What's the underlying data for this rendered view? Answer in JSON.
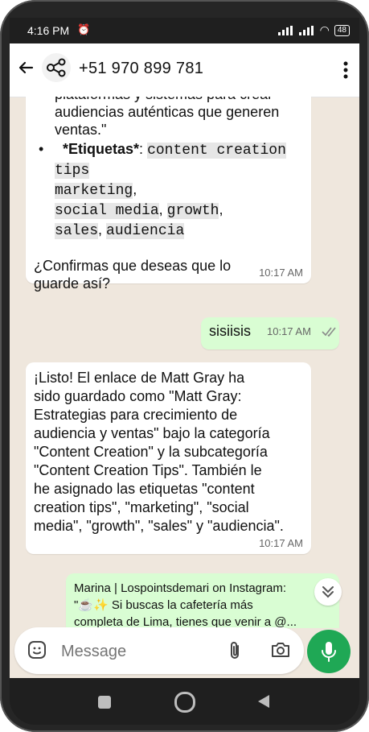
{
  "status": {
    "time": "4:16 PM",
    "battery": "48"
  },
  "header": {
    "contact": "+51 970 899 781"
  },
  "chat": {
    "msg1": {
      "text_line1": "plataformas y sistemas para crear",
      "text_line2": "audiencias auténticas que generen",
      "text_line3": "ventas.\"",
      "tags_label": "*Etiquetas*",
      "tags_colon": ":",
      "tags": [
        "content creation tips",
        "marketing",
        "social media",
        "growth",
        "sales",
        "audiencia"
      ],
      "confirm_line1": "¿Confirmas que deseas que lo",
      "confirm_line2": "guarde así?",
      "time": "10:17 AM"
    },
    "msg2": {
      "text": "sisiisis",
      "time": "10:17 AM"
    },
    "msg3": {
      "lines": [
        "¡Listo! El enlace de Matt Gray ha",
        "sido guardado como \"Matt Gray:",
        "Estrategias para crecimiento de",
        "audiencia y ventas\" bajo la categoría",
        "\"Content Creation\" y la subcategoría",
        "\"Content Creation Tips\". También le",
        "he asignado las etiquetas \"content",
        "creation tips\", \"marketing\", \"social",
        "media\", \"growth\", \"sales\" y \"audiencia\"."
      ],
      "time": "10:17 AM"
    },
    "msg4": {
      "line1": "Marina | Lospointsdemari on Instagram:",
      "line2": "\"☕✨ Si buscas la cafetería más",
      "line3": "completa de Lima, tienes que venir a @..."
    }
  },
  "composer": {
    "placeholder": "Message"
  },
  "icons": {
    "back": "back-arrow-icon",
    "share": "share-icon",
    "more": "more-vertical-icon",
    "emoji": "emoji-icon",
    "attach": "paperclip-icon",
    "camera": "camera-icon",
    "mic": "mic-icon",
    "nav_square": "square-icon",
    "nav_home": "home-circle-icon",
    "nav_back": "triangle-back-icon"
  },
  "colors": {
    "accent": "#1fa855",
    "out_bubble": "#d9fdd3",
    "chat_bg": "#efe7dd"
  }
}
